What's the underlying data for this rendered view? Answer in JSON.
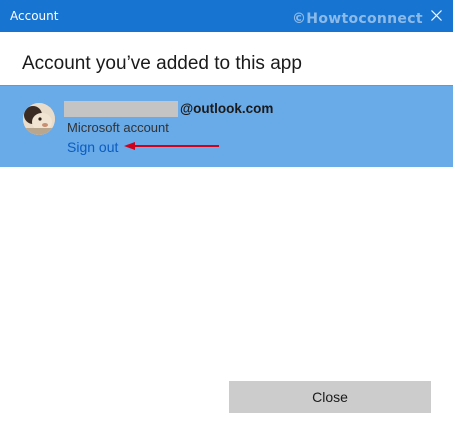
{
  "window": {
    "title": "Account",
    "watermark": "©Howtoconnect",
    "close_icon": "close-icon"
  },
  "heading": "Account you’ve added to this app",
  "account": {
    "email_domain": "@outlook.com",
    "type": "Microsoft account",
    "sign_out_label": "Sign out"
  },
  "footer": {
    "close_label": "Close"
  },
  "colors": {
    "titlebar": "#1874d1",
    "selected_card": "#69aae8",
    "link": "#0a5dbf",
    "arrow": "#d0021b",
    "button": "#cccccc"
  }
}
